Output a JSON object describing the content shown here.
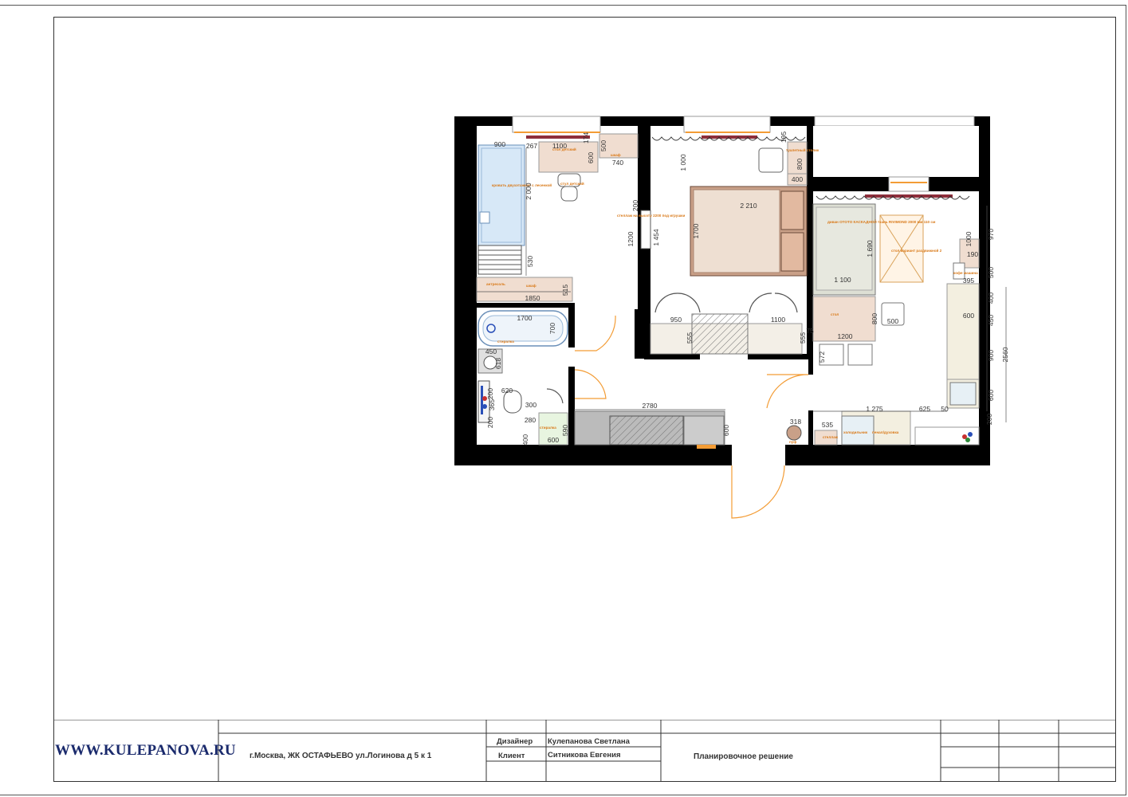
{
  "stamp": {
    "website": "WWW.KULEPANOVA.RU",
    "address": "г.Москва, ЖК ОСТАФЬЕВО ул.Логинова д 5 к 1",
    "designer_label": "Дизайнер",
    "designer_name": "Кулепанова Светлана",
    "client_label": "Клиент",
    "client_name": "Ситникова Евгения",
    "sheet_title": "Планировочное решение"
  },
  "plan": {
    "furniture_labels": {
      "bed_bunk": "кровать двухэтажная с лесенкой",
      "desk_kids": "стол детский",
      "chair_kids": "стул детский",
      "wardrobe_kids": "шкаф",
      "mezzanine": "антресоль",
      "wardrobe_hall": "шкаф",
      "shelving": "стеллаж на высоту 2200 под игрушки",
      "dresser": "туалетный столик",
      "bathtub": "стиралка",
      "boiler": "стиралка",
      "sofa": "диван OTOTO КАСКАДНОЙ ткань RIVIMOND 2000 мм 110 см",
      "tv_stand": "стол вариант раздвижной 2",
      "table": "стол",
      "fridge": "холодильник",
      "oven": "пенал/духовка",
      "puff": "пуф",
      "shelf": "стеллаж",
      "coffee": "кофе машина"
    },
    "dimensions": [
      {
        "id": "d1",
        "text": "900"
      },
      {
        "id": "d2",
        "text": "267"
      },
      {
        "id": "d3",
        "text": "1100"
      },
      {
        "id": "d4",
        "text": "174"
      },
      {
        "id": "d5",
        "text": "500"
      },
      {
        "id": "d6",
        "text": "600"
      },
      {
        "id": "d7",
        "text": "740"
      },
      {
        "id": "d8",
        "text": "2 000"
      },
      {
        "id": "d9",
        "text": "530"
      },
      {
        "id": "d10",
        "text": "515"
      },
      {
        "id": "d11",
        "text": "1850"
      },
      {
        "id": "d12",
        "text": "200"
      },
      {
        "id": "d13",
        "text": "1200"
      },
      {
        "id": "d14",
        "text": "1 454"
      },
      {
        "id": "d15",
        "text": "1 000"
      },
      {
        "id": "d16",
        "text": "2 210"
      },
      {
        "id": "d17",
        "text": "1700"
      },
      {
        "id": "d18",
        "text": "195"
      },
      {
        "id": "d19",
        "text": "800"
      },
      {
        "id": "d20",
        "text": "400"
      },
      {
        "id": "d21",
        "text": "1700"
      },
      {
        "id": "d22",
        "text": "700"
      },
      {
        "id": "d23",
        "text": "450"
      },
      {
        "id": "d24",
        "text": "618"
      },
      {
        "id": "d25",
        "text": "620"
      },
      {
        "id": "d26",
        "text": "300"
      },
      {
        "id": "d27",
        "text": "280"
      },
      {
        "id": "d28",
        "text": "400"
      },
      {
        "id": "d29",
        "text": "590"
      },
      {
        "id": "d30",
        "text": "600"
      },
      {
        "id": "d31",
        "text": "200"
      },
      {
        "id": "d32",
        "text": "365"
      },
      {
        "id": "d33",
        "text": "200"
      },
      {
        "id": "d34",
        "text": "950"
      },
      {
        "id": "d35",
        "text": "555"
      },
      {
        "id": "d36",
        "text": "1100"
      },
      {
        "id": "d37",
        "text": "555"
      },
      {
        "id": "d38",
        "text": "75"
      },
      {
        "id": "d39",
        "text": "2780"
      },
      {
        "id": "d40",
        "text": "600"
      },
      {
        "id": "d41",
        "text": "1 690"
      },
      {
        "id": "d42",
        "text": "1 100"
      },
      {
        "id": "d43",
        "text": "800"
      },
      {
        "id": "d44",
        "text": "500"
      },
      {
        "id": "d45",
        "text": "1200"
      },
      {
        "id": "d46",
        "text": "572"
      },
      {
        "id": "d47",
        "text": "1 275"
      },
      {
        "id": "d48",
        "text": "625"
      },
      {
        "id": "d49",
        "text": "50"
      },
      {
        "id": "d50",
        "text": "535"
      },
      {
        "id": "d51",
        "text": "318"
      },
      {
        "id": "d52",
        "text": "1000"
      },
      {
        "id": "d53",
        "text": "190"
      },
      {
        "id": "d54",
        "text": "395"
      },
      {
        "id": "d55",
        "text": "600"
      },
      {
        "id": "d56",
        "text": "970"
      },
      {
        "id": "d57",
        "text": "500"
      },
      {
        "id": "d58",
        "text": "400"
      },
      {
        "id": "d59",
        "text": "450"
      },
      {
        "id": "d60",
        "text": "900"
      },
      {
        "id": "d61",
        "text": "600"
      },
      {
        "id": "d62",
        "text": "200"
      },
      {
        "id": "d63",
        "text": "2560"
      }
    ]
  }
}
